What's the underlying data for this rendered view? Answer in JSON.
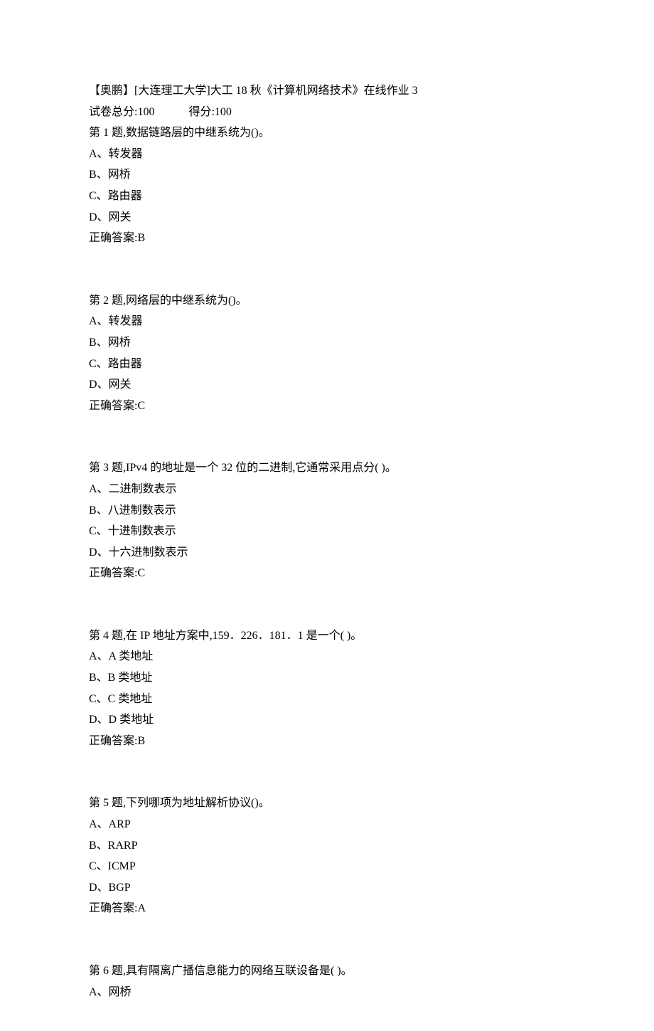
{
  "header": {
    "title": "【奥鹏】[大连理工大学]大工 18 秋《计算机网络技术》在线作业 3",
    "total_label": "试卷总分:100",
    "score_label": "得分:100"
  },
  "questions": [
    {
      "stem": "第 1 题,数据链路层的中继系统为()。",
      "options": [
        "A、转发器",
        "B、网桥",
        "C、路由器",
        "D、网关"
      ],
      "answer": "正确答案:B"
    },
    {
      "stem": "第 2 题,网络层的中继系统为()。",
      "options": [
        "A、转发器",
        "B、网桥",
        "C、路由器",
        "D、网关"
      ],
      "answer": "正确答案:C"
    },
    {
      "stem": "第 3 题,IPv4 的地址是一个 32 位的二进制,它通常采用点分( )。",
      "options": [
        "A、二进制数表示",
        "B、八进制数表示",
        "C、十进制数表示",
        "D、十六进制数表示"
      ],
      "answer": "正确答案:C"
    },
    {
      "stem": "第 4 题,在 IP 地址方案中,159．226．181．1 是一个( )。",
      "options": [
        "A、A 类地址",
        "B、B 类地址",
        "C、C 类地址",
        "D、D 类地址"
      ],
      "answer": "正确答案:B"
    },
    {
      "stem": "第 5 题,下列哪项为地址解析协议()。",
      "options": [
        "A、ARP",
        "B、RARP",
        "C、ICMP",
        "D、BGP"
      ],
      "answer": "正确答案:A"
    },
    {
      "stem": "第 6 题,具有隔离广播信息能力的网络互联设备是( )。",
      "options": [
        "A、网桥"
      ],
      "answer": null
    }
  ]
}
